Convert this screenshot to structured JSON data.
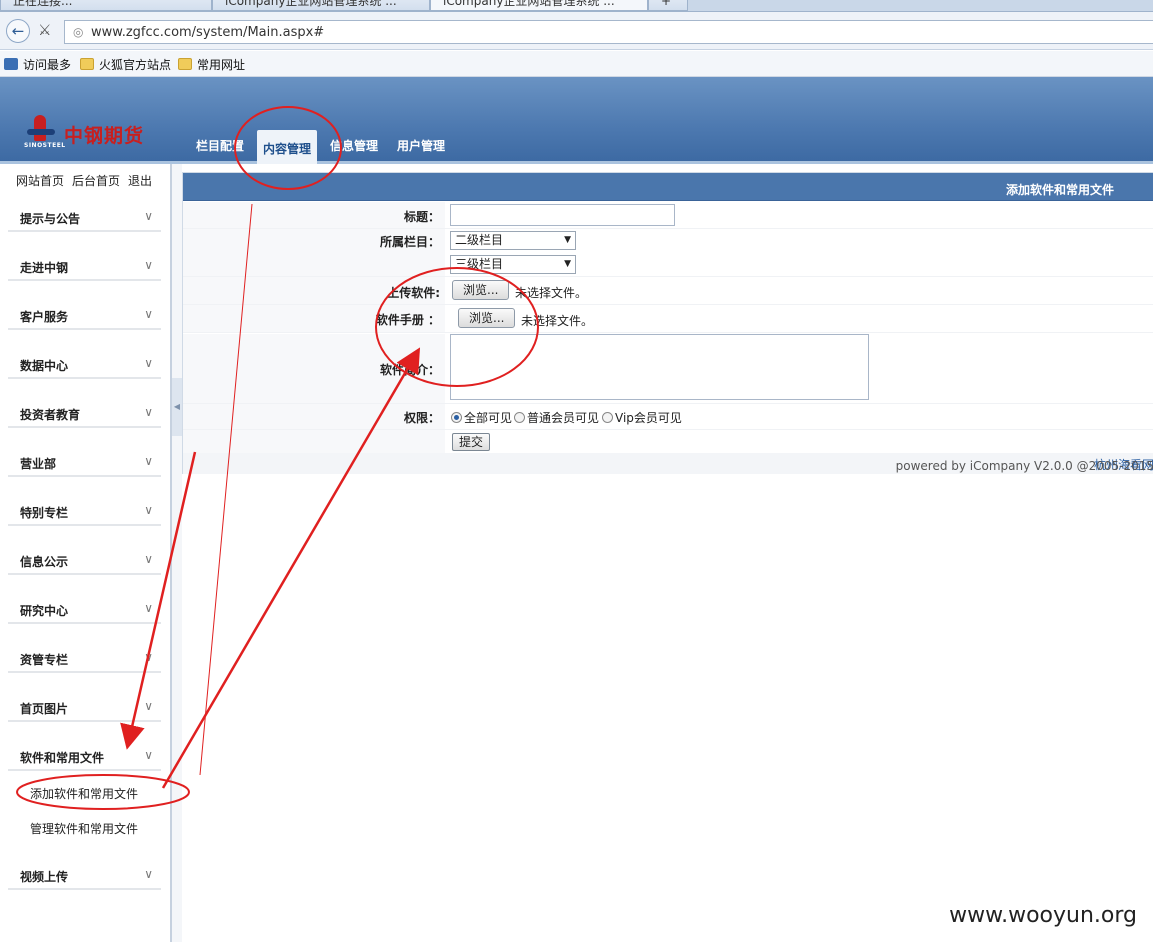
{
  "browser": {
    "tabs": [
      "正在连接...",
      "iCompany企业网站管理系统 ...",
      "iCompany企业网站管理系统 ..."
    ],
    "url": "www.zgfcc.com/system/Main.aspx#",
    "bookmarks": [
      "访问最多",
      "火狐官方站点",
      "常用网址"
    ]
  },
  "header": {
    "logo_cn": "中钢期货",
    "logo_en": "SINOSTEEL",
    "nav": [
      "栏目配置",
      "内容管理",
      "信息管理",
      "用户管理"
    ],
    "active_nav": "内容管理"
  },
  "sidebar": {
    "toplinks": [
      "网站首页",
      "后台首页",
      "退出"
    ],
    "menu": [
      "提示与公告",
      "走进中钢",
      "客户服务",
      "数据中心",
      "投资者教育",
      "营业部",
      "特别专栏",
      "信息公示",
      "研究中心",
      "资管专栏",
      "首页图片",
      "软件和常用文件",
      "视频上传"
    ],
    "submenu": [
      "添加软件和常用文件",
      "管理软件和常用文件"
    ]
  },
  "form": {
    "title_bar": "添加软件和常用文件",
    "labels": {
      "title": "标题：",
      "category": "所属栏目：",
      "upload": "上传软件:",
      "manual": "软件手册 ：",
      "intro": "软件简介：",
      "permission": "权限："
    },
    "title_value": "",
    "select1": "二级栏目",
    "select2": "三级栏目",
    "browse_label": "浏览...",
    "no_file": "未选择文件。",
    "radios": [
      "全部可见",
      "普通会员可见",
      "Vip会员可见"
    ],
    "radio_selected": 0,
    "submit": "提交",
    "footer_powered": "powered by iCompany V2.0.0 @2005-2015",
    "footer_company": "杭州海看网"
  },
  "watermark": "www.wooyun.org",
  "colors": {
    "header_blue": "#4d79b0",
    "annotation_red": "#e02020",
    "logo_red": "#c81f1f"
  }
}
